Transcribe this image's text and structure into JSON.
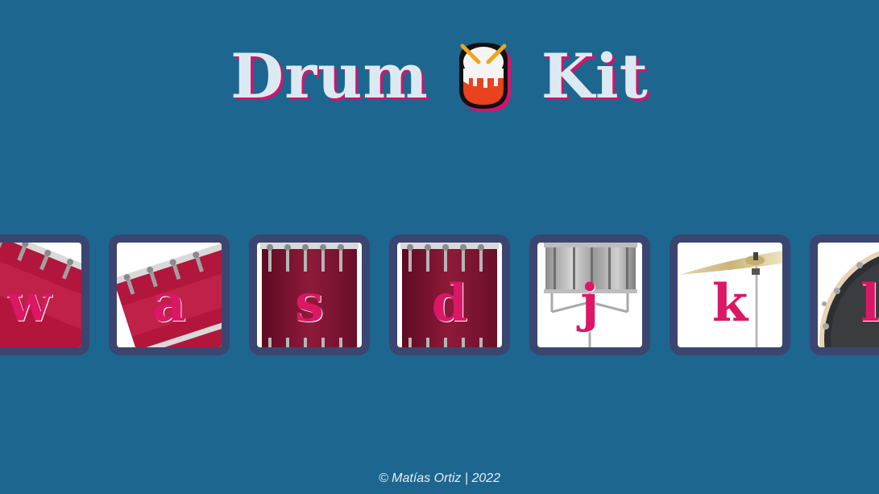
{
  "header": {
    "title_left": "Drum",
    "title_icon": "drum-icon",
    "title_right": "Kit"
  },
  "keys": [
    {
      "letter": "w",
      "instrument_icon": "tom-drum-icon"
    },
    {
      "letter": "a",
      "instrument_icon": "tom-drum-icon"
    },
    {
      "letter": "s",
      "instrument_icon": "snare-drum-icon"
    },
    {
      "letter": "d",
      "instrument_icon": "snare-drum-icon"
    },
    {
      "letter": "j",
      "instrument_icon": "snare-stand-icon"
    },
    {
      "letter": "k",
      "instrument_icon": "cymbal-icon"
    },
    {
      "letter": "l",
      "instrument_icon": "bass-drum-icon"
    }
  ],
  "footer": {
    "copyright": "© Matías Ortiz | 2022"
  },
  "colors": {
    "background": "#1d668f",
    "key_border": "#3a4670",
    "accent": "#db1766",
    "title_text": "#dbeaf2"
  }
}
